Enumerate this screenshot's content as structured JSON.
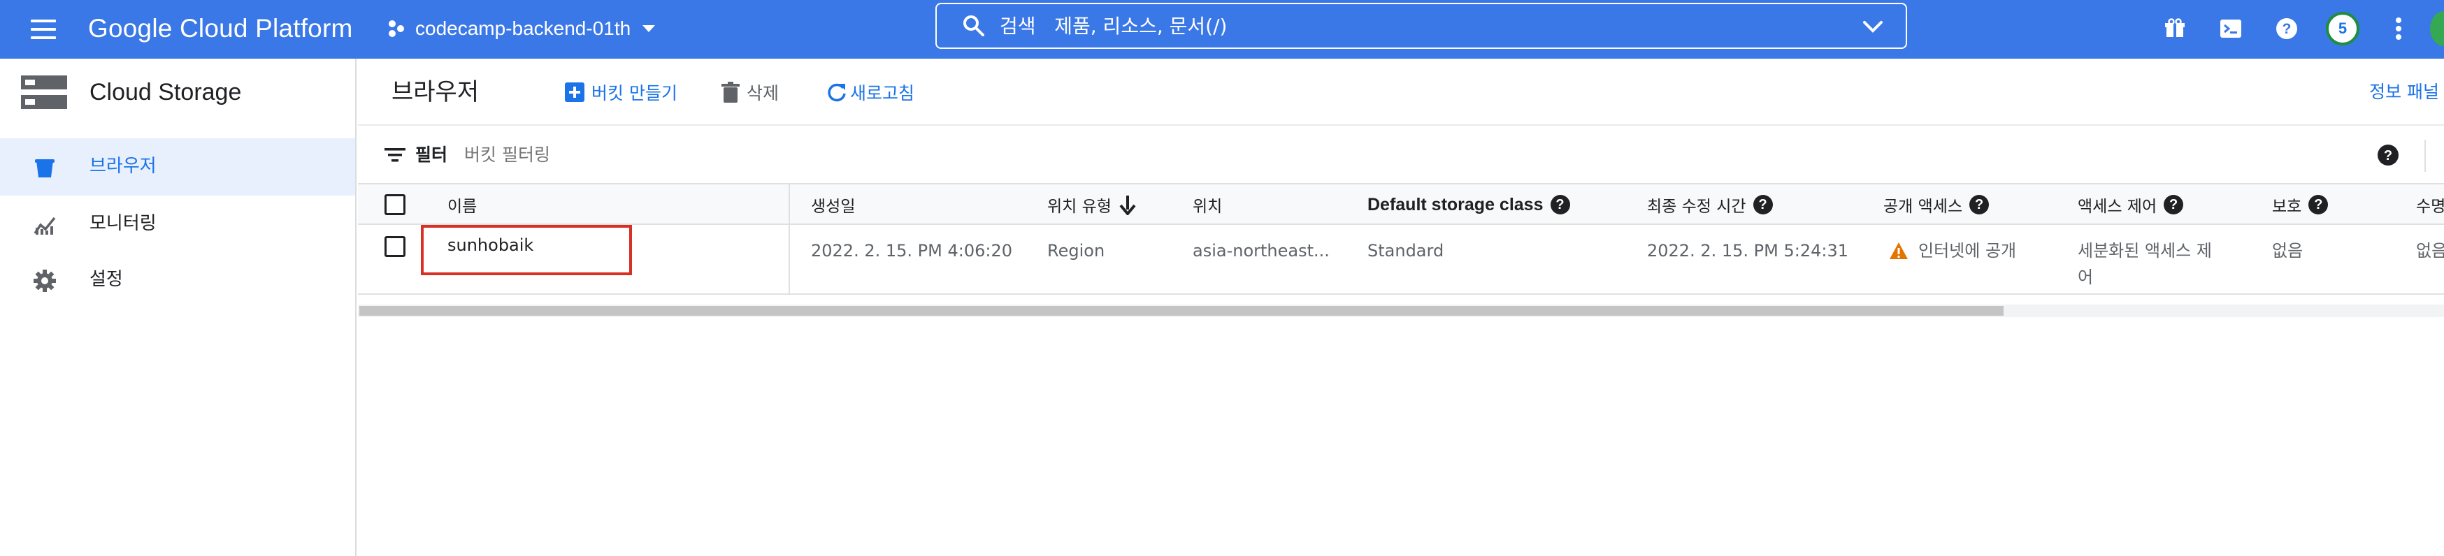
{
  "topbar": {
    "brand": "Google Cloud Platform",
    "project": "codecamp-backend-01th",
    "search_label": "검색",
    "search_placeholder": "제품, 리소스, 문서(/)",
    "avatar_initial": "5",
    "icons": [
      "gift-icon",
      "cloud-shell-icon",
      "help-icon",
      "more-vert-icon"
    ],
    "bar_color": "#3b78e7"
  },
  "sidebar": {
    "title": "Cloud Storage",
    "items": [
      {
        "label": "브라우저",
        "icon": "bucket-icon",
        "active": true
      },
      {
        "label": "모니터링",
        "icon": "chart-icon",
        "active": false
      },
      {
        "label": "설정",
        "icon": "gear-icon",
        "active": false
      }
    ]
  },
  "toolbar": {
    "title": "브라우저",
    "create_bucket": "버킷 만들기",
    "delete": "삭제",
    "refresh": "새로고침",
    "info_panel": "정보 패널 표"
  },
  "filter": {
    "label": "필터",
    "placeholder": "버킷 필터링"
  },
  "table": {
    "columns": {
      "name": "이름",
      "created": "생성일",
      "location_type": "위치 유형",
      "location": "위치",
      "storage_class": "Default storage class",
      "modified": "최종 수정 시간",
      "public_access": "공개 액세스",
      "access_control": "액세스 제어",
      "protection": "보호",
      "lifecycle": "수명"
    },
    "rows": [
      {
        "name": "sunhobaik",
        "created": "2022. 2. 15. PM 4:06:20",
        "location_type": "Region",
        "location": "asia-northeast...",
        "storage_class": "Standard",
        "modified": "2022. 2. 15. PM 5:24:31",
        "public_access": "인터넷에 공개",
        "access_control_line1": "세분화된 액세스 제",
        "access_control_line2": "어",
        "protection": "없음",
        "lifecycle": "없음"
      }
    ]
  },
  "colors": {
    "accent": "#1a73e8",
    "warning": "#e37400",
    "highlight": "#d93025"
  }
}
